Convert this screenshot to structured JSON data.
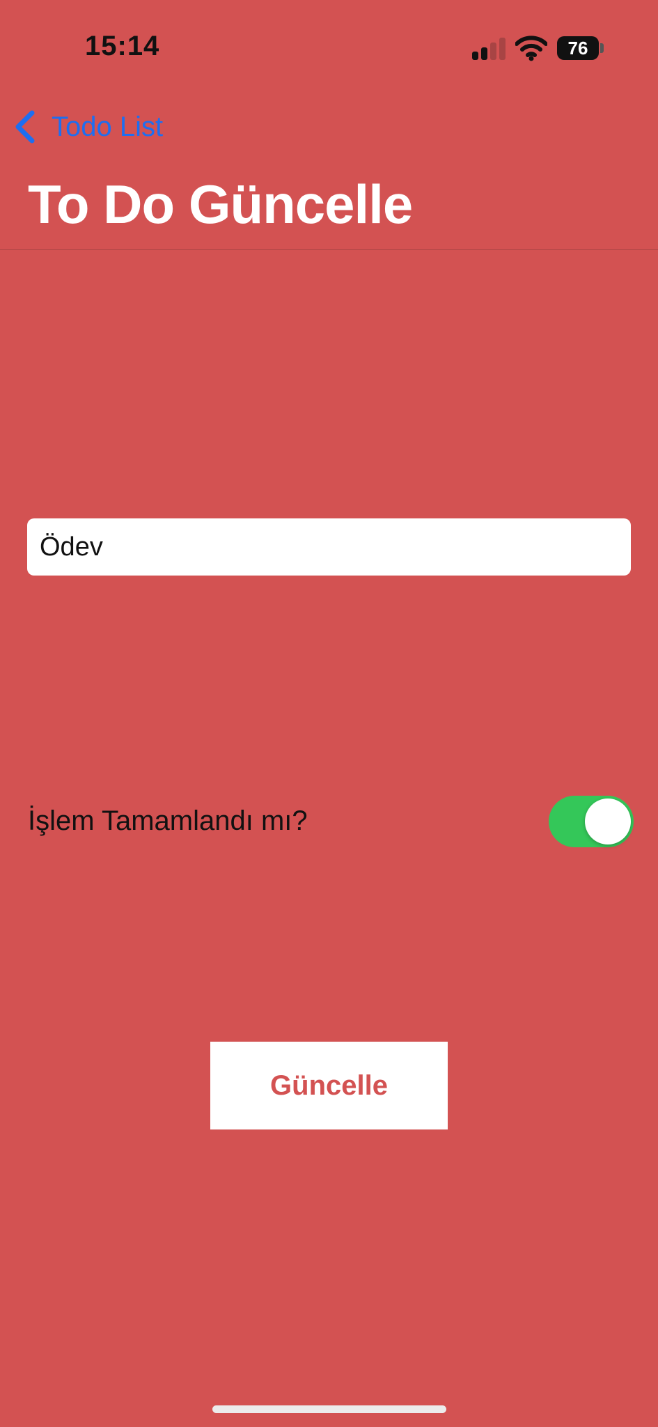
{
  "status_bar": {
    "time": "15:14",
    "battery_level": "76",
    "icons": [
      "cellular-signal-icon",
      "wifi-icon",
      "battery-icon"
    ]
  },
  "nav": {
    "back_label": "Todo List",
    "back_icon": "chevron-left-icon",
    "title": "To Do Güncelle"
  },
  "form": {
    "task_value": "Ödev",
    "completed_label": "İşlem Tamamlandı mı?",
    "completed_on": true,
    "update_label": "Güncelle"
  },
  "colors": {
    "background": "#D35252",
    "accent_blue": "#1E6EF0",
    "toggle_on": "#34C759",
    "button_bg": "#FFFFFF",
    "button_text": "#D35252"
  }
}
